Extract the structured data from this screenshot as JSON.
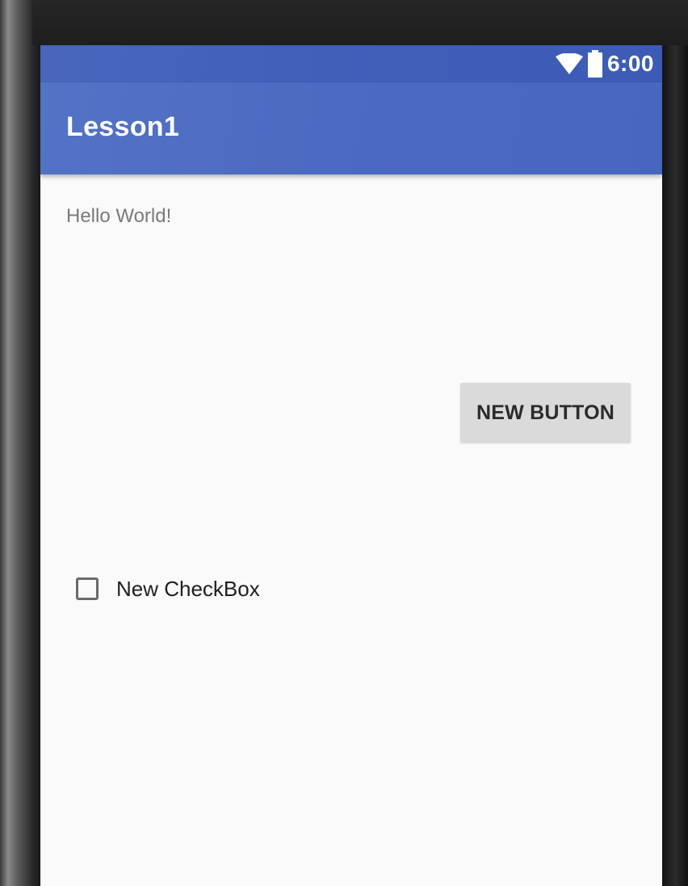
{
  "status_bar": {
    "time": "6:00",
    "icons": [
      "wifi-icon",
      "battery-icon"
    ]
  },
  "app_bar": {
    "title": "Lesson1"
  },
  "content": {
    "hello_text": "Hello World!",
    "button_label": "NEW BUTTON",
    "checkbox_label": "New CheckBox",
    "checkbox_checked": false
  },
  "colors": {
    "primary": "#4b6bc2",
    "primary_dark": "#3f5fb9",
    "background": "#fafafa",
    "button_bg": "#dadada"
  }
}
